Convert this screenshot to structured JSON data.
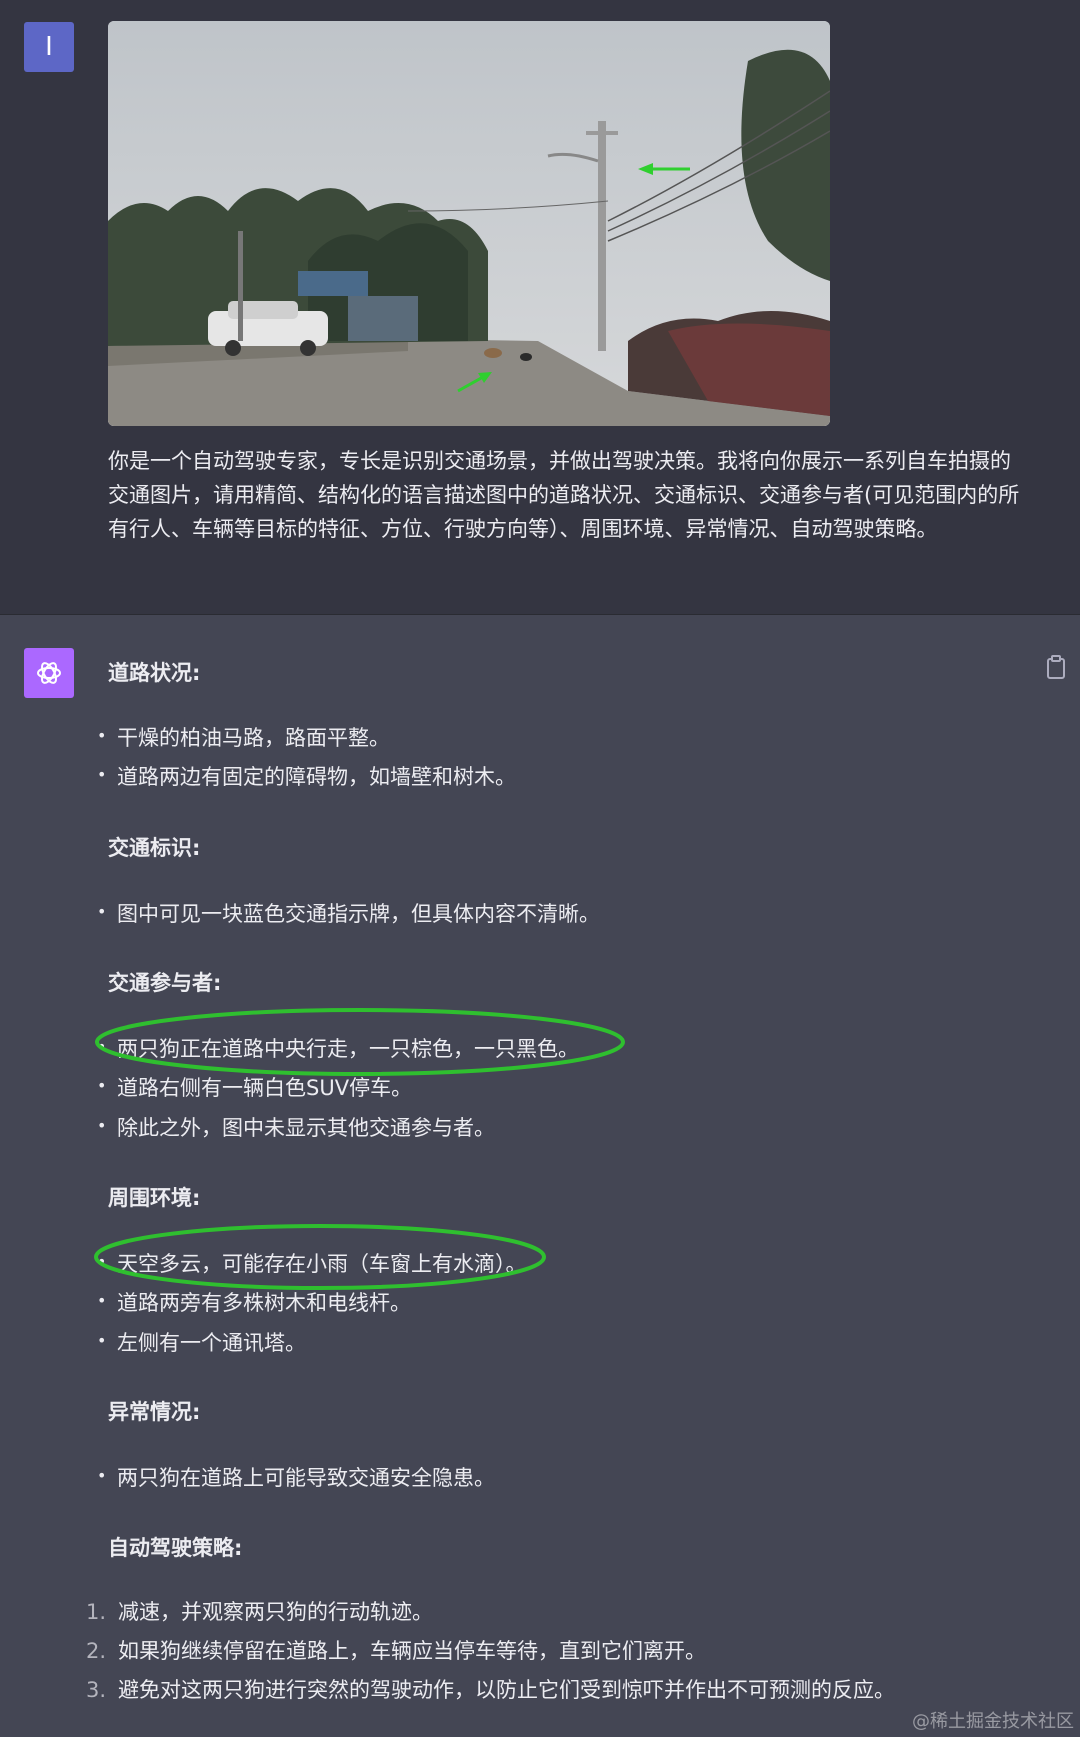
{
  "user": {
    "avatar_letter": "I",
    "prompt": "你是一个自动驾驶专家，专长是识别交通场景，并做出驾驶决策。我将向你展示一系列自车拍摄的交通图片，请用精简、结构化的语言描述图中的道路状况、交通标识、交通参与者(可见范围内的所有行人、车辆等目标的特征、方位、行驶方向等）、周围环境、异常情况、自动驾驶策略。"
  },
  "assistant": {
    "sections": [
      {
        "title": "道路状况:",
        "items": [
          "干燥的柏油马路，路面平整。",
          "道路两边有固定的障碍物，如墙壁和树木。"
        ]
      },
      {
        "title": "交通标识:",
        "items": [
          "图中可见一块蓝色交通指示牌，但具体内容不清晰。"
        ]
      },
      {
        "title": "交通参与者:",
        "items": [
          "两只狗正在道路中央行走，一只棕色，一只黑色。",
          "道路右侧有一辆白色SUV停车。",
          "除此之外，图中未显示其他交通参与者。"
        ]
      },
      {
        "title": "周围环境:",
        "items": [
          "天空多云，可能存在小雨（车窗上有水滴）。",
          "道路两旁有多株树木和电线杆。",
          "左侧有一个通讯塔。"
        ]
      },
      {
        "title": "异常情况:",
        "items": [
          "两只狗在道路上可能导致交通安全隐患。"
        ]
      },
      {
        "title": "自动驾驶策略:",
        "numbered": [
          "减速，并观察两只狗的行动轨迹。",
          "如果狗继续停留在道路上，车辆应当停车等待，直到它们离开。",
          "避免对这两只狗进行突然的驾驶动作，以防止它们受到惊吓并作出不可预测的反应。"
        ]
      }
    ]
  },
  "watermark": "@稀土掘金技术社区",
  "colors": {
    "user_bg": "#343541",
    "assistant_bg": "#444654",
    "user_avatar": "#5d67c6",
    "gpt_avatar": "#ab68ff",
    "highlight": "#2fbf2f"
  }
}
